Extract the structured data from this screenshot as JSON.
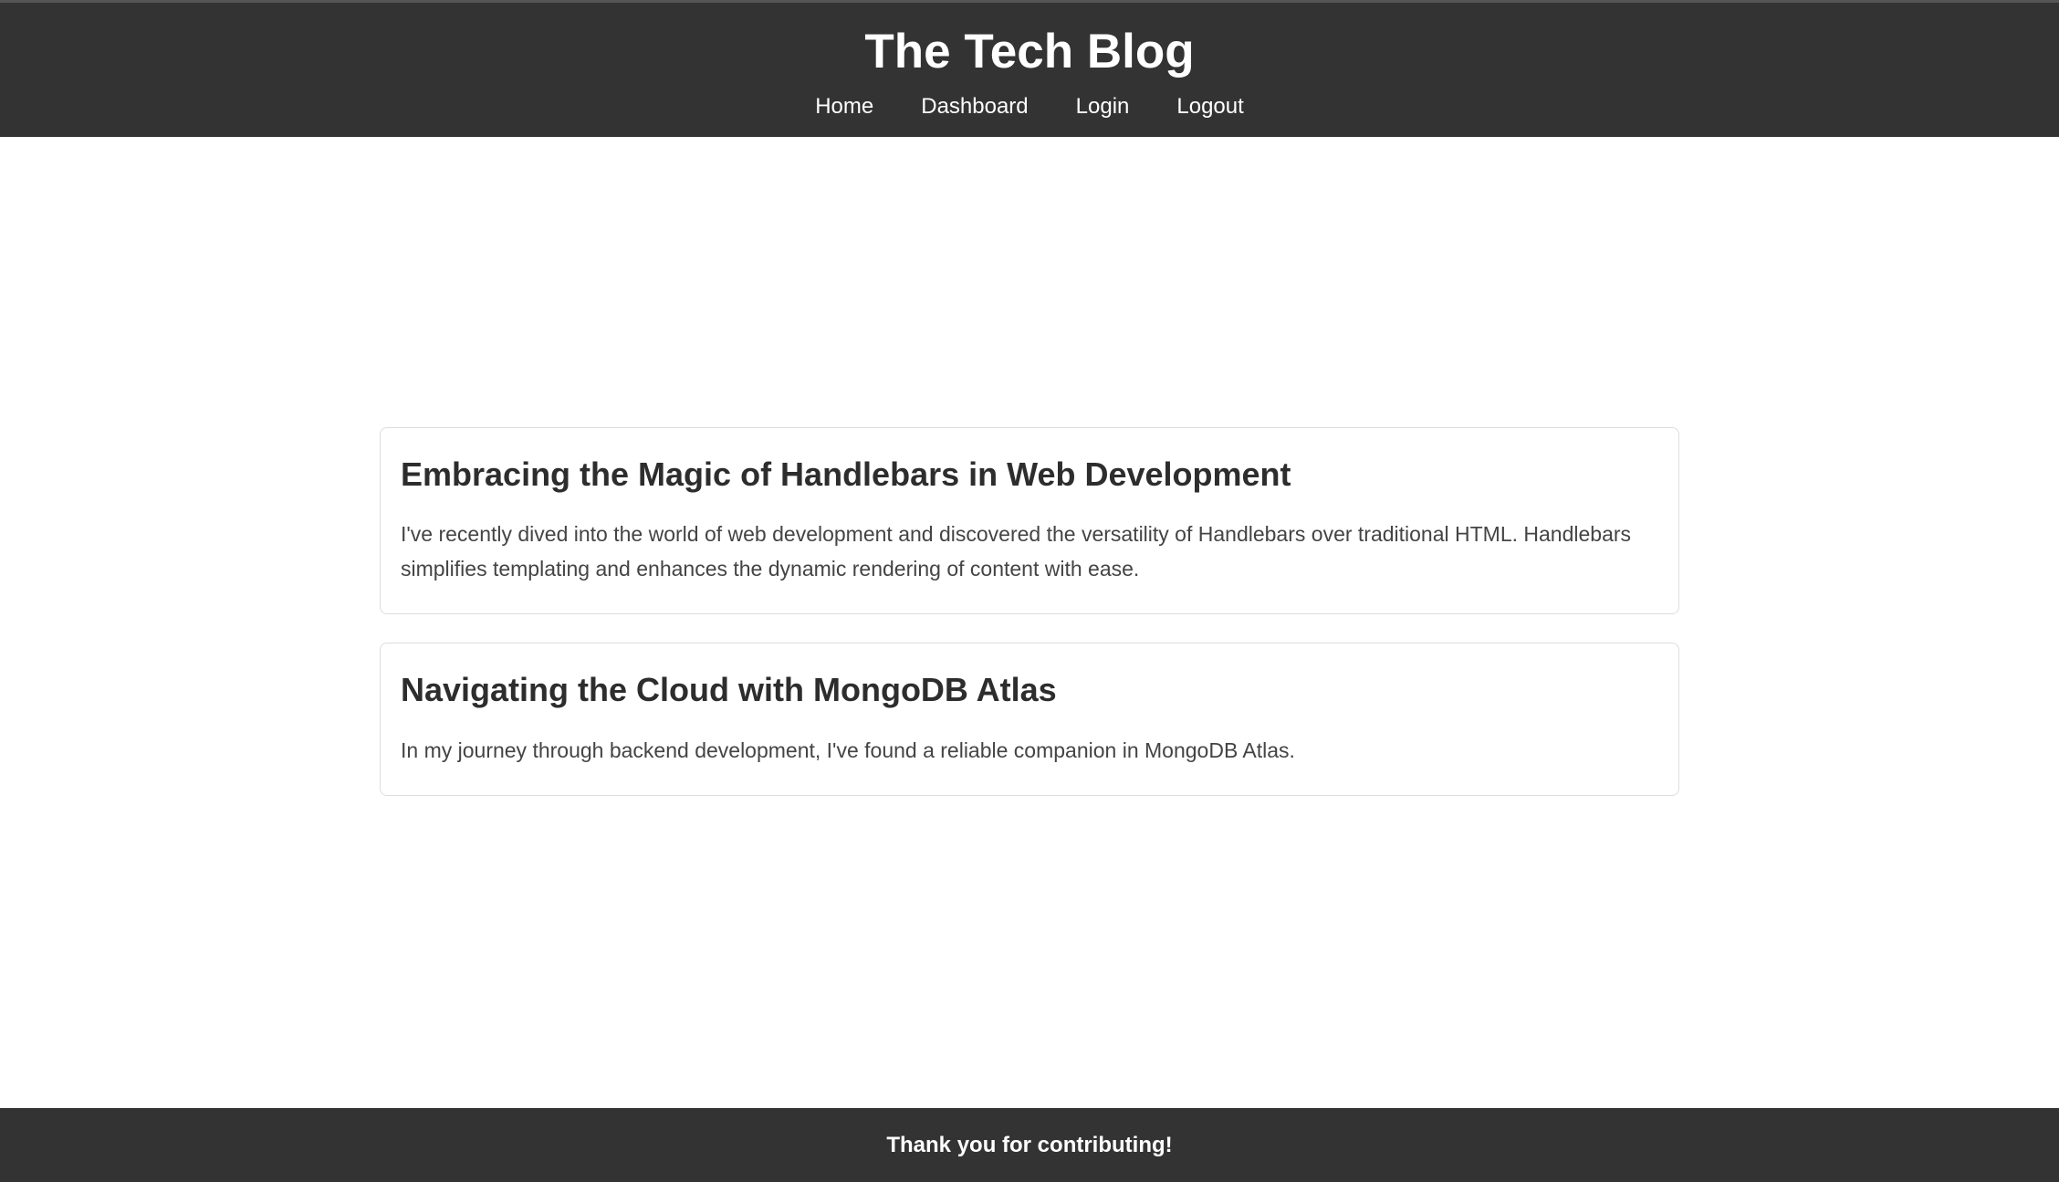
{
  "header": {
    "title": "The Tech Blog",
    "nav": [
      {
        "label": "Home"
      },
      {
        "label": "Dashboard"
      },
      {
        "label": "Login"
      },
      {
        "label": "Logout"
      }
    ]
  },
  "posts": [
    {
      "title": "Embracing the Magic of Handlebars in Web Development",
      "body": "I've recently dived into the world of web development and discovered the versatility of Handlebars over traditional HTML. Handlebars simplifies templating and enhances the dynamic rendering of content with ease."
    },
    {
      "title": "Navigating the Cloud with MongoDB Atlas",
      "body": "In my journey through backend development, I've found a reliable companion in MongoDB Atlas."
    }
  ],
  "footer": {
    "text": "Thank you for contributing!"
  },
  "colors": {
    "header_bg": "#333333",
    "footer_bg": "#333333",
    "text_dark": "#2d2d2d"
  }
}
